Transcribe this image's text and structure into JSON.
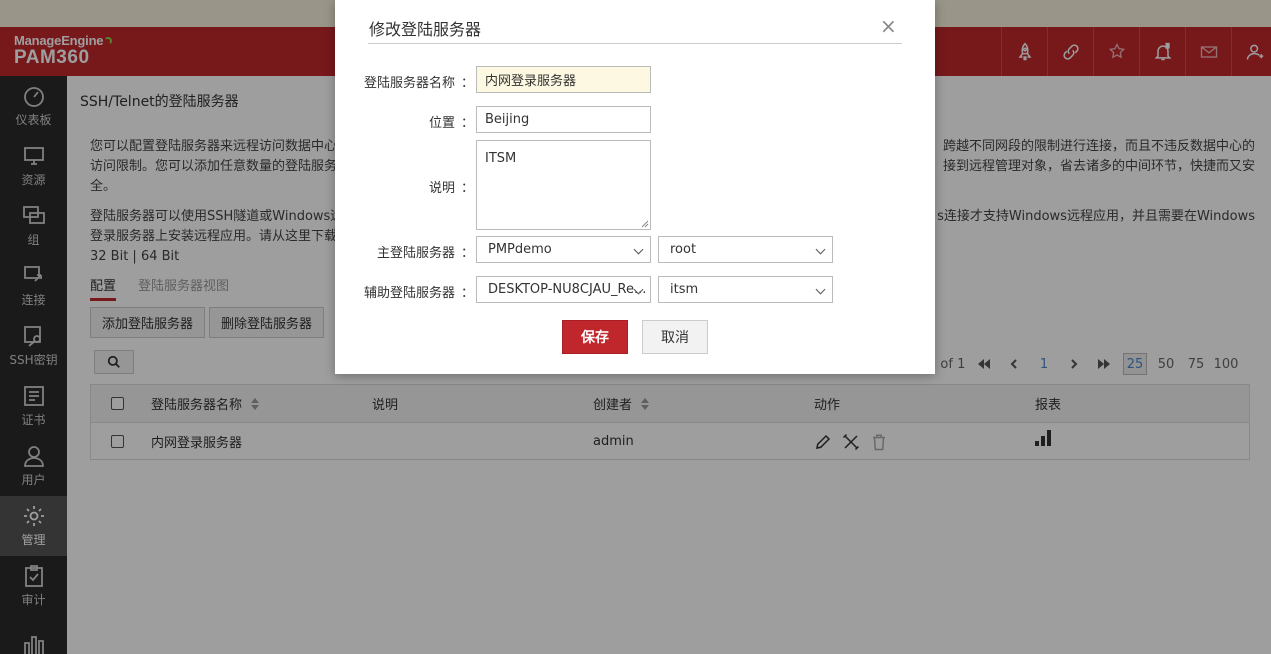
{
  "brand": {
    "manageengine": "ManageEngine",
    "product": "PAM360"
  },
  "sidebar": {
    "items": [
      {
        "label": "仪表板",
        "icon": "dashboard-icon"
      },
      {
        "label": "资源",
        "icon": "monitor-icon"
      },
      {
        "label": "组",
        "icon": "group-icon"
      },
      {
        "label": "连接",
        "icon": "connection-icon"
      },
      {
        "label": "SSH密钥",
        "icon": "key-icon"
      },
      {
        "label": "证书",
        "icon": "certificate-icon"
      },
      {
        "label": "用户",
        "icon": "user-icon"
      },
      {
        "label": "管理",
        "icon": "gear-icon",
        "active": true
      },
      {
        "label": "审计",
        "icon": "clipboard-check-icon"
      },
      {
        "label": "",
        "icon": "report-icon"
      }
    ]
  },
  "page": {
    "title": "SSH/Telnet的登陆服务器",
    "desc1_left": "您可以配置登陆服务器来远程访问数据中心",
    "desc1_right": "跨越不同网段的限制进行连接，而且不违反数据中心的",
    "desc2_left": "访问限制。您可以添加任意数量的登陆服务",
    "desc2_right": "接到远程管理对象，省去诸多的中间环节，快捷而又安",
    "desc3": "全。",
    "desc4_left": "登陆服务器可以使用SSH隧道或Windows远",
    "desc4_right": "s连接才支持Windows远程应用，并且需要在Windows",
    "desc5_left": "登录服务器上安装远程应用。请从这里下载",
    "desc6": "32 Bit | 64 Bit"
  },
  "tabs": [
    {
      "label": "配置"
    },
    {
      "label": "登陆服务器视图"
    }
  ],
  "toolbar": {
    "add_label": "添加登陆服务器",
    "delete_label": "删除登陆服务器"
  },
  "pager": {
    "of_text": "l of 1",
    "page": "1",
    "sizes": [
      "25",
      "50",
      "75",
      "100"
    ]
  },
  "table": {
    "headers": {
      "name": "登陆服务器名称",
      "desc": "说明",
      "creator": "创建者",
      "action": "动作",
      "report": "报表"
    },
    "rows": [
      {
        "name": "内网登录服务器",
        "desc": "",
        "creator": "admin"
      }
    ]
  },
  "modal": {
    "title": "修改登陆服务器",
    "close": "×",
    "name_label": "登陆服务器名称",
    "name_value": "内网登录服务器",
    "location_label": "位置",
    "location_value": "Beijing",
    "desc_label": "说明",
    "desc_value": "ITSM",
    "primary_label": "主登陆服务器",
    "primary_server": "PMPdemo",
    "primary_account": "root",
    "secondary_label": "辅助登陆服务器",
    "secondary_server": "DESKTOP-NU8CJAU_Re...",
    "secondary_account": "itsm",
    "colon": "：",
    "save_label": "保存",
    "cancel_label": "取消"
  },
  "colors": {
    "brand_red": "#c0272d",
    "sidebar_bg": "#2b2b2b",
    "active_nav": "#555555"
  }
}
